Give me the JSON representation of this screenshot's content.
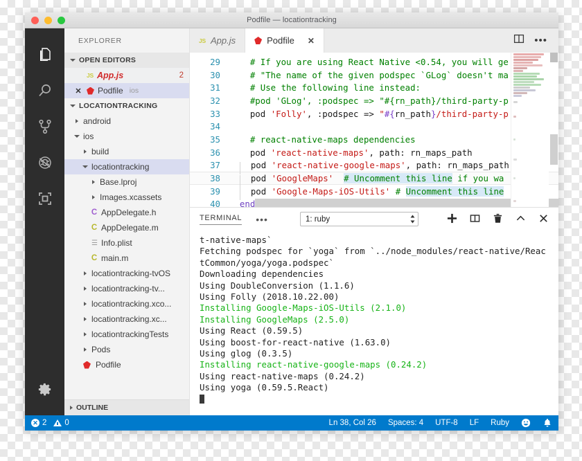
{
  "window": {
    "title": "Podfile — locationtracking",
    "traffic_lights": [
      "close",
      "minimize",
      "zoom"
    ]
  },
  "activity_bar": {
    "items": [
      {
        "name": "explorer-icon",
        "label": "Explorer",
        "active": true
      },
      {
        "name": "search-icon",
        "label": "Search",
        "active": false
      },
      {
        "name": "source-control-icon",
        "label": "Source Control",
        "active": false
      },
      {
        "name": "debug-icon",
        "label": "Run and Debug",
        "active": false
      },
      {
        "name": "extensions-icon",
        "label": "Extensions",
        "active": false
      }
    ],
    "bottom": [
      {
        "name": "gear-icon",
        "label": "Manage"
      }
    ]
  },
  "sidebar": {
    "title": "EXPLORER",
    "open_editors": {
      "header": "OPEN EDITORS",
      "items": [
        {
          "icon": "js-badge",
          "name": "App.js",
          "modified": true,
          "count": "2",
          "folder": ""
        },
        {
          "icon": "ruby-gem",
          "name": "Podfile",
          "modified": false,
          "count": "",
          "folder": "ios",
          "selected": true,
          "close": "✕"
        }
      ]
    },
    "project": {
      "header": "LOCATIONTRACKING",
      "items": [
        {
          "label": "android",
          "indent": 0,
          "type": "folder",
          "expanded": false
        },
        {
          "label": "ios",
          "indent": 0,
          "type": "folder",
          "expanded": true
        },
        {
          "label": "build",
          "indent": 1,
          "type": "folder",
          "expanded": false
        },
        {
          "label": "locationtracking",
          "indent": 1,
          "type": "folder",
          "expanded": true,
          "selected": true
        },
        {
          "label": "Base.lproj",
          "indent": 2,
          "type": "folder",
          "expanded": false
        },
        {
          "label": "Images.xcassets",
          "indent": 2,
          "type": "folder",
          "expanded": false
        },
        {
          "label": "AppDelegate.h",
          "indent": 2,
          "type": "c-header"
        },
        {
          "label": "AppDelegate.m",
          "indent": 2,
          "type": "c-source"
        },
        {
          "label": "Info.plist",
          "indent": 2,
          "type": "plist"
        },
        {
          "label": "main.m",
          "indent": 2,
          "type": "c-source"
        },
        {
          "label": "locationtracking-tvOS",
          "indent": 1,
          "type": "folder",
          "expanded": false
        },
        {
          "label": "locationtracking-tv...",
          "indent": 1,
          "type": "folder",
          "expanded": false
        },
        {
          "label": "locationtracking.xco...",
          "indent": 1,
          "type": "folder",
          "expanded": false
        },
        {
          "label": "locationtracking.xc...",
          "indent": 1,
          "type": "folder",
          "expanded": false
        },
        {
          "label": "locationtrackingTests",
          "indent": 1,
          "type": "folder",
          "expanded": false
        },
        {
          "label": "Pods",
          "indent": 1,
          "type": "folder",
          "expanded": false
        },
        {
          "label": "Podfile",
          "indent": 1,
          "type": "ruby"
        }
      ]
    },
    "outline": {
      "header": "OUTLINE"
    }
  },
  "editor": {
    "tabs": [
      {
        "label": "App.js",
        "icon": "js-badge",
        "active": false,
        "italic": true
      },
      {
        "label": "Podfile",
        "icon": "ruby-gem",
        "active": true,
        "close": "✕"
      }
    ],
    "actions": [
      {
        "name": "split-editor-icon",
        "label": "Split Editor"
      },
      {
        "name": "more-actions-icon",
        "label": "More Actions..."
      }
    ],
    "lines": [
      {
        "no": "29",
        "text": "# If you are using React Native <0.54, you will ge"
      },
      {
        "no": "30",
        "text": "# \"The name of the given podspec `GLog` doesn't ma"
      },
      {
        "no": "31",
        "text": "# Use the following line instead:"
      },
      {
        "no": "32",
        "text": "#pod 'GLog', :podspec => \"#{rn_path}/third-party-p"
      },
      {
        "no": "33",
        "text": "pod 'Folly', :podspec => \"#{rn_path}/third-party-p"
      },
      {
        "no": "34",
        "text": ""
      },
      {
        "no": "35",
        "text": "# react-native-maps dependencies"
      },
      {
        "no": "36",
        "text": "pod 'react-native-maps', path: rn_maps_path"
      },
      {
        "no": "37",
        "text": "  pod 'react-native-google-maps', path: rn_maps_path"
      },
      {
        "no": "38",
        "text": "  pod 'GoogleMaps'  # Uncomment this line if you wa"
      },
      {
        "no": "39",
        "text": "  pod 'Google-Maps-iOS-Utils' # Uncomment this line"
      },
      {
        "no": "40",
        "text": "end"
      }
    ]
  },
  "panel": {
    "tab_label": "TERMINAL",
    "more_label": "•••",
    "select_value": "1: ruby",
    "actions": [
      {
        "name": "add-terminal-icon",
        "label": "New Terminal"
      },
      {
        "name": "split-terminal-icon",
        "label": "Split Terminal"
      },
      {
        "name": "kill-terminal-icon",
        "label": "Kill Terminal"
      },
      {
        "name": "maximize-panel-icon",
        "label": "Maximize Panel Size"
      },
      {
        "name": "close-panel-icon",
        "label": "Close Panel"
      }
    ],
    "terminal_lines": [
      {
        "text": "t-native-maps`",
        "color": "default"
      },
      {
        "text": "Fetching podspec for `yoga` from `../node_modules/react-native/Reac",
        "color": "default"
      },
      {
        "text": "tCommon/yoga/yoga.podspec`",
        "color": "default"
      },
      {
        "text": "Downloading dependencies",
        "color": "default"
      },
      {
        "text": "Using DoubleConversion (1.1.6)",
        "color": "default"
      },
      {
        "text": "Using Folly (2018.10.22.00)",
        "color": "default"
      },
      {
        "text": "Installing Google-Maps-iOS-Utils (2.1.0)",
        "color": "green"
      },
      {
        "text": "Installing GoogleMaps (2.5.0)",
        "color": "green"
      },
      {
        "text": "Using React (0.59.5)",
        "color": "default"
      },
      {
        "text": "Using boost-for-react-native (1.63.0)",
        "color": "default"
      },
      {
        "text": "Using glog (0.3.5)",
        "color": "default"
      },
      {
        "text": "Installing react-native-google-maps (0.24.2)",
        "color": "green"
      },
      {
        "text": "Using react-native-maps (0.24.2)",
        "color": "default"
      },
      {
        "text": "Using yoga (0.59.5.React)",
        "color": "default"
      }
    ]
  },
  "status_bar": {
    "errors": "2",
    "warnings": "0",
    "cursor_position": "Ln 38, Col 26",
    "indentation": "Spaces: 4",
    "encoding": "UTF-8",
    "eol": "LF",
    "language": "Ruby",
    "feedback_icon": "smiley-icon",
    "notifications_icon": "bell-icon"
  },
  "colors": {
    "accent": "#007acc",
    "activity_bar": "#2d2d2d",
    "sidebar": "#f3f3f3",
    "selection": "#d9dcf0",
    "comment": "#008000",
    "string": "#c41a16",
    "keyword": "#6f42c1",
    "line_number": "#2b91af",
    "terminal_green": "#17b317",
    "modified_file": "#d12b2b"
  }
}
